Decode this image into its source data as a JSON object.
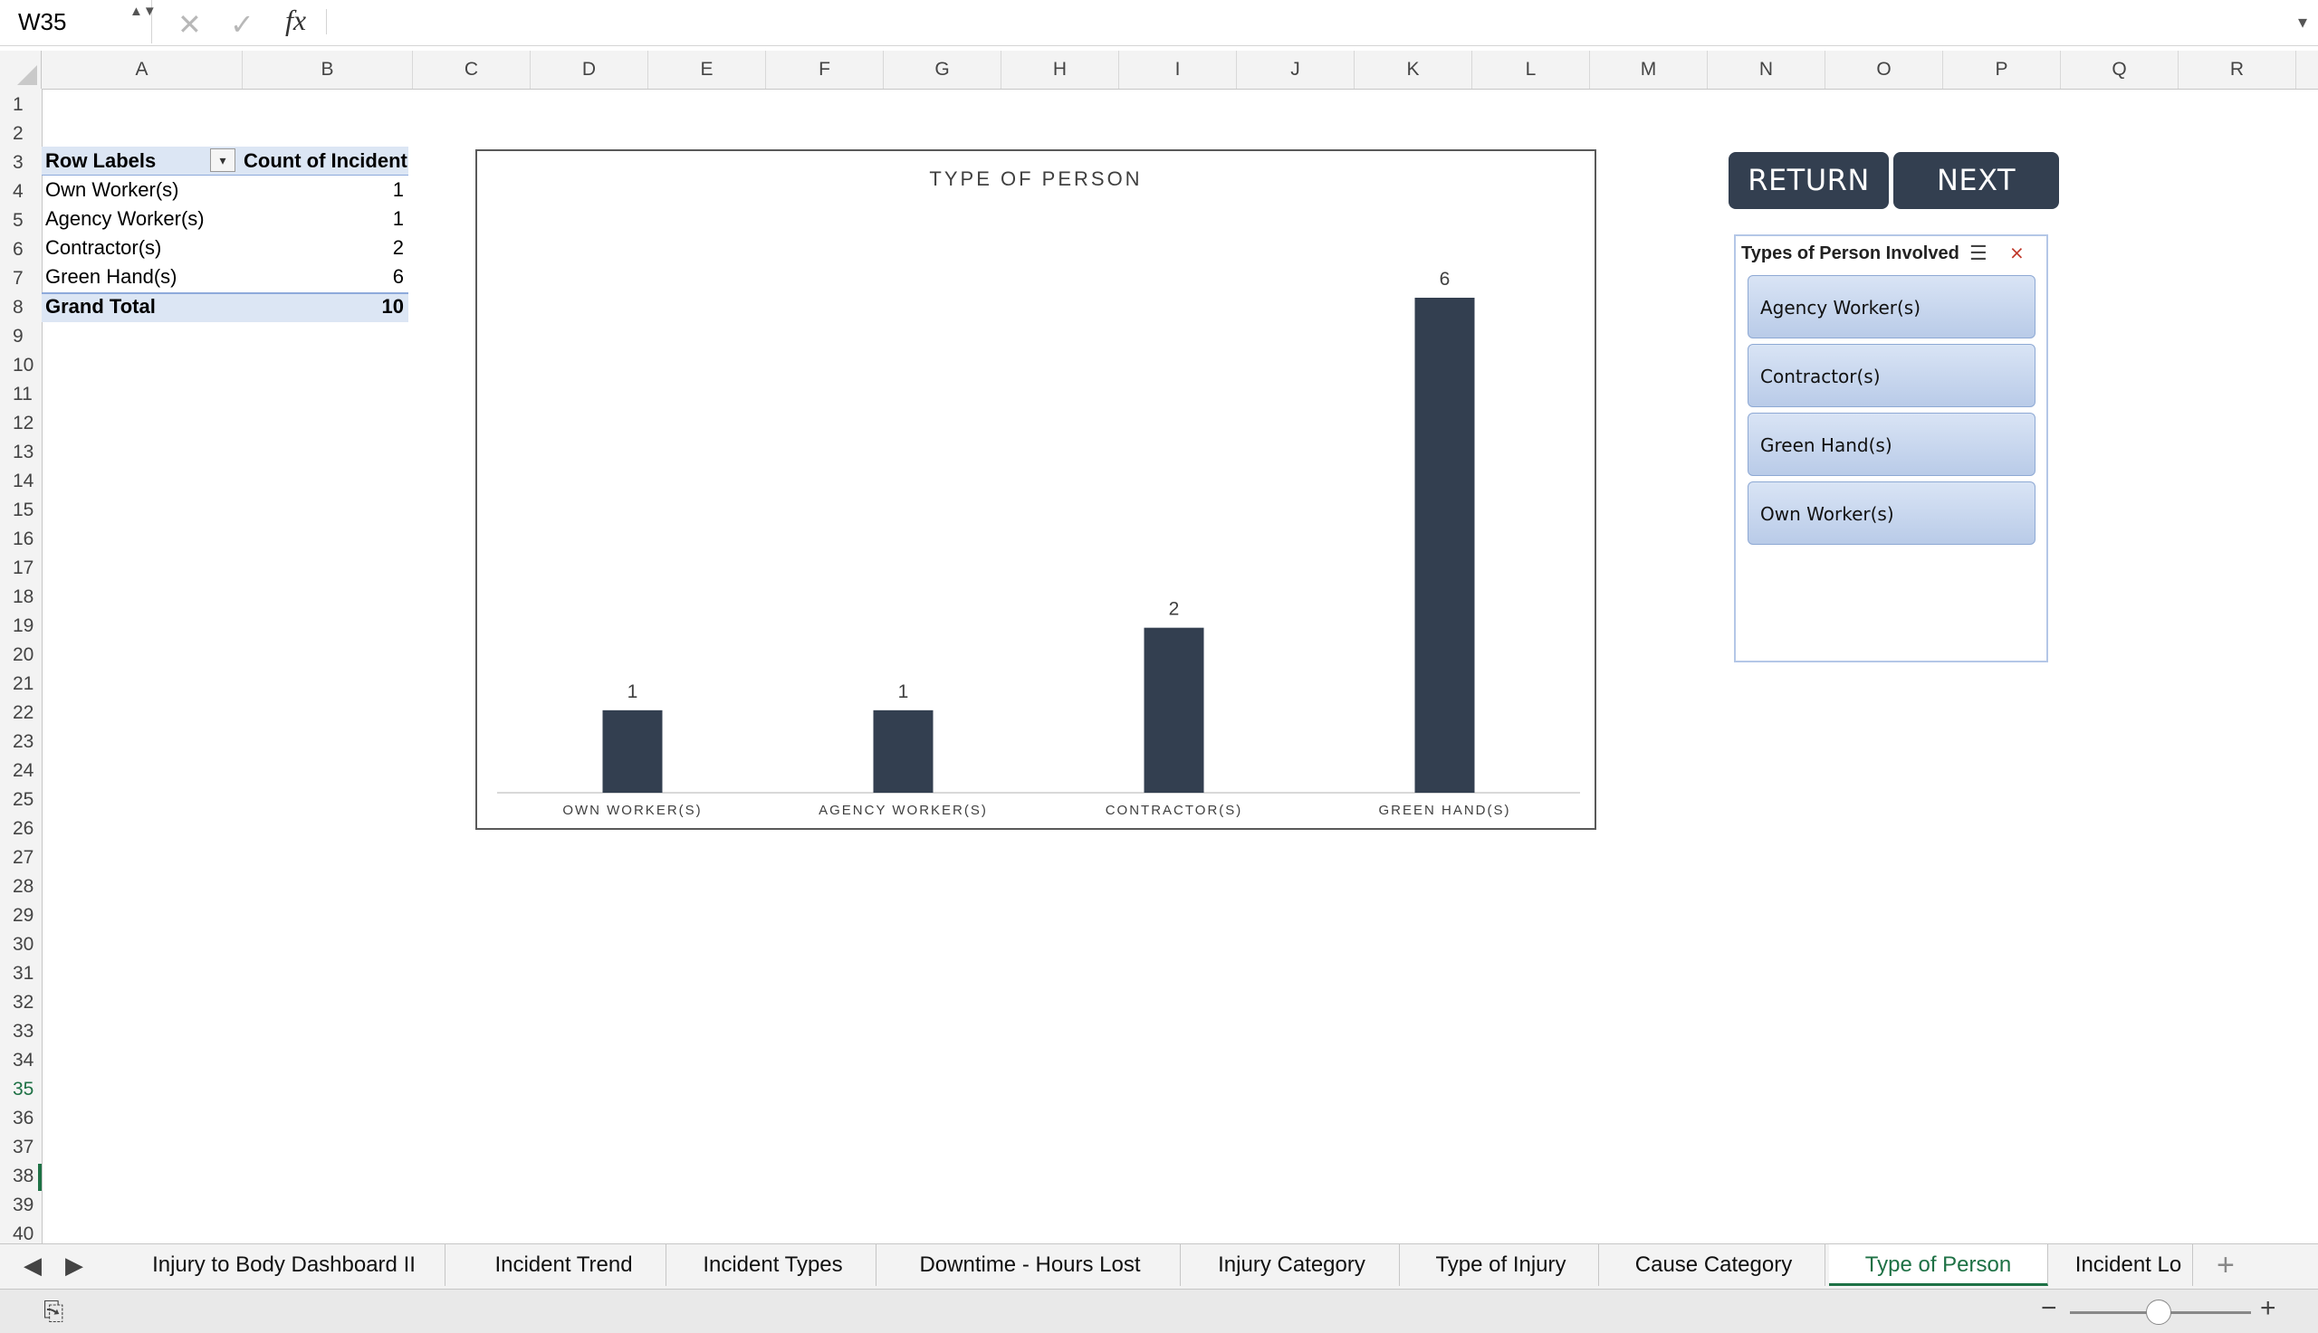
{
  "formula_bar": {
    "name_box": "W35",
    "spinner": "▲▼",
    "cancel_glyph": "✕",
    "confirm_glyph": "✓",
    "fx_label": "fx",
    "formula_value": "",
    "expand_glyph": "▾"
  },
  "columns": [
    "A",
    "B",
    "C",
    "D",
    "E",
    "F",
    "G",
    "H",
    "I",
    "J",
    "K",
    "L",
    "M",
    "N",
    "O",
    "P",
    "Q",
    "R"
  ],
  "rows": [
    "1",
    "2",
    "3",
    "4",
    "5",
    "6",
    "7",
    "8",
    "9",
    "10",
    "11",
    "12",
    "13",
    "14",
    "15",
    "16",
    "17",
    "18",
    "19",
    "20",
    "21",
    "22",
    "23",
    "24",
    "25",
    "26",
    "27",
    "28",
    "29",
    "30",
    "31",
    "32",
    "33",
    "34",
    "35",
    "36",
    "37",
    "38",
    "39",
    "40"
  ],
  "active_cell_row": "35",
  "pivot": {
    "header_label": "Row Labels",
    "header_value": "Count of Incident",
    "filter_glyph": "▾",
    "rows": [
      {
        "label": "Own Worker(s)",
        "value": "1"
      },
      {
        "label": "Agency Worker(s)",
        "value": "1"
      },
      {
        "label": "Contractor(s)",
        "value": "2"
      },
      {
        "label": "Green Hand(s)",
        "value": "6"
      }
    ],
    "total_label": "Grand Total",
    "total_value": "10"
  },
  "buttons": {
    "return_label": "RETURN",
    "next_label": "NEXT"
  },
  "slicer": {
    "title": "Types of Person Involved",
    "multi_select_icon": "multi-select-icon",
    "clear_filter_icon": "clear-filter-icon",
    "items": [
      "Agency Worker(s)",
      "Contractor(s)",
      "Green Hand(s)",
      "Own Worker(s)"
    ]
  },
  "chart_data": {
    "type": "bar",
    "title": "TYPE OF PERSON",
    "categories": [
      "OWN WORKER(S)",
      "AGENCY WORKER(S)",
      "CONTRACTOR(S)",
      "GREEN HAND(S)"
    ],
    "values": [
      1,
      1,
      2,
      6
    ],
    "data_labels": [
      "1",
      "1",
      "2",
      "6"
    ],
    "bar_color": "#333f50",
    "ylim": [
      0,
      6
    ],
    "grid": false,
    "legend": "none"
  },
  "sheet_tabs": {
    "prev_glyph": "◀",
    "next_glyph": "▶",
    "tabs": [
      "Injury to Body Dashboard II",
      "Incident Trend",
      "Incident Types",
      "Downtime - Hours Lost",
      "Injury Category",
      "Type of Injury",
      "Cause Category",
      "Type of Person",
      "Incident Lo"
    ],
    "active_tab": "Type of Person",
    "add_glyph": "+"
  },
  "status_bar": {
    "zoom_minus": "−",
    "zoom_plus": "+",
    "zoom_level": 0.45
  },
  "colors": {
    "accent_green": "#1e7145",
    "button_dark": "#333f50",
    "pivot_header": "#dce6f4",
    "slicer_item": "#b9cbe8"
  }
}
